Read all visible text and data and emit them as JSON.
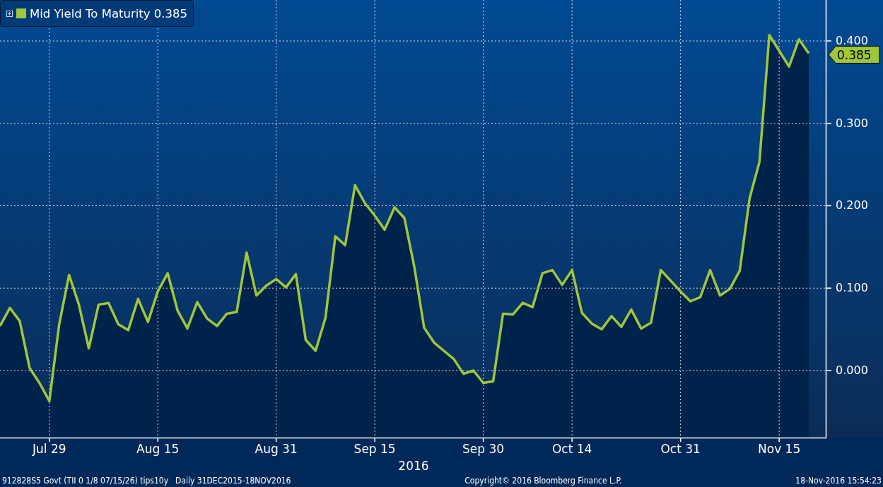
{
  "legend": {
    "value": "0.385"
  },
  "chart": {
    "last_value_tag": "0.385",
    "chart_data": {
      "type": "line",
      "grid": true,
      "xlabel": "2016",
      "ylim": [
        -0.0814,
        0.4497
      ],
      "categories": [
        null,
        null,
        null,
        null,
        null,
        "Jul 29",
        null,
        null,
        null,
        null,
        null,
        null,
        null,
        null,
        null,
        null,
        "Aug 15",
        null,
        null,
        null,
        null,
        null,
        null,
        null,
        null,
        null,
        null,
        null,
        "Aug 31",
        null,
        null,
        null,
        null,
        null,
        null,
        null,
        null,
        null,
        "Sep 15",
        null,
        null,
        null,
        null,
        null,
        null,
        null,
        null,
        null,
        null,
        "Sep 30",
        null,
        null,
        null,
        null,
        null,
        null,
        null,
        null,
        "Oct 14",
        null,
        null,
        null,
        null,
        null,
        null,
        null,
        null,
        null,
        null,
        "Oct 31",
        null,
        null,
        null,
        null,
        null,
        null,
        null,
        null,
        null,
        "Nov 15",
        null,
        null,
        null
      ],
      "series": [
        {
          "name": "Mid Yield To Maturity",
          "color": "#a0c63a",
          "values": [
            0.054,
            0.076,
            0.06,
            0.003,
            -0.015,
            -0.037,
            0.056,
            0.116,
            0.08,
            0.027,
            0.08,
            0.082,
            0.056,
            0.049,
            0.087,
            0.059,
            0.096,
            0.118,
            0.073,
            0.051,
            0.083,
            0.063,
            0.054,
            0.069,
            0.071,
            0.143,
            0.091,
            0.103,
            0.111,
            0.101,
            0.117,
            0.037,
            0.024,
            0.064,
            0.163,
            0.152,
            0.225,
            0.203,
            0.188,
            0.171,
            0.198,
            0.185,
            0.126,
            0.052,
            0.034,
            0.024,
            0.014,
            -0.004,
            0.0,
            -0.015,
            -0.013,
            0.069,
            0.068,
            0.082,
            0.077,
            0.118,
            0.122,
            0.104,
            0.122,
            0.07,
            0.057,
            0.05,
            0.066,
            0.053,
            0.074,
            0.051,
            0.058,
            0.122,
            0.109,
            0.096,
            0.084,
            0.089,
            0.122,
            0.091,
            0.099,
            0.121,
            0.209,
            0.253,
            0.407,
            0.388,
            0.369,
            0.402,
            0.385
          ]
        }
      ],
      "yticks": [
        {
          "value": 0,
          "label": "0.000"
        },
        {
          "value": 0.1,
          "label": "0.100"
        },
        {
          "value": 0.2,
          "label": "0.200"
        },
        {
          "value": 0.3,
          "label": "0.300"
        },
        {
          "value": 0.4,
          "label": "0.400"
        }
      ]
    }
  },
  "footer": {
    "security": "912828S5 Govt (TII 0 1/8 07/15/26) tips10y",
    "period": "Daily 31DEC2015-18NOV2016",
    "copyright": "Copyright© 2016 Bloomberg Finance L.P.",
    "timestamp": "18-Nov-2016 15:54:23"
  }
}
